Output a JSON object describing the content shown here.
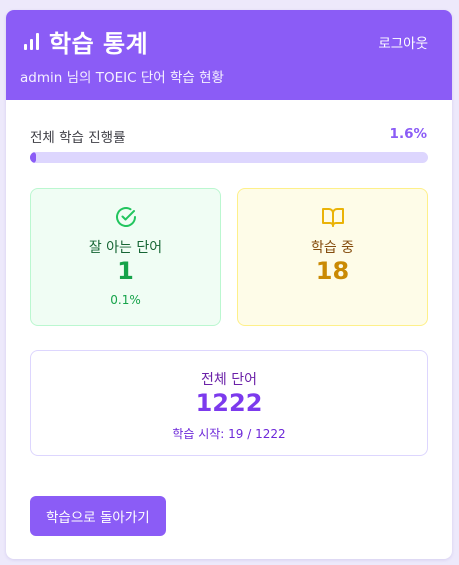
{
  "header": {
    "title": "학습 통계",
    "logout_label": "로그아웃",
    "subtitle": "admin 님의 TOEIC 단어 학습 현황"
  },
  "progress": {
    "label": "전체 학습 진행률",
    "percent_text": "1.6%",
    "percent": 1.6
  },
  "stats": {
    "known": {
      "icon": "check-circle-icon",
      "label": "잘 아는 단어",
      "value": "1",
      "percent_text": "0.1%"
    },
    "learning": {
      "icon": "book-open-icon",
      "label": "학습 중",
      "value": "18"
    }
  },
  "total": {
    "label": "전체 단어",
    "value": "1222",
    "started_text": "학습 시작: 19 / 1222"
  },
  "actions": {
    "back_label": "학습으로 돌아가기"
  },
  "colors": {
    "accent": "#8b5cf6",
    "known": "#16a34a",
    "learning": "#ca8a04",
    "progress_track": "#ddd6fe"
  }
}
